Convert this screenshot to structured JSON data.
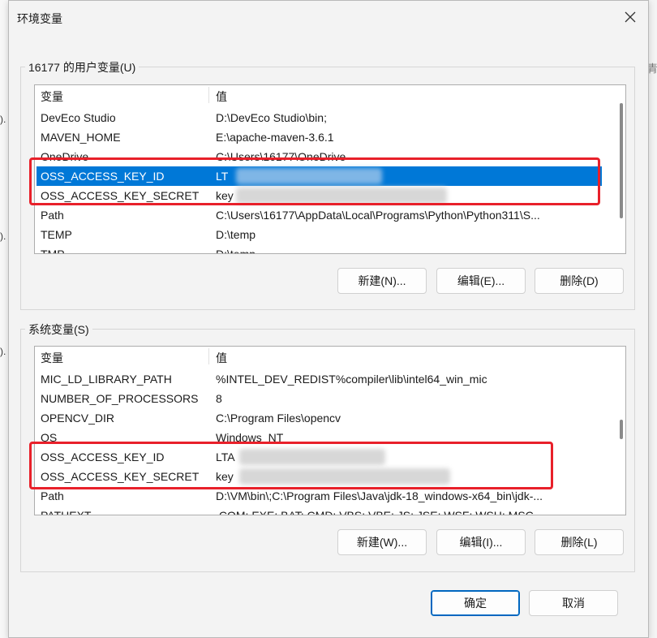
{
  "dialog": {
    "title": "环境变量"
  },
  "background": {
    "left_marks": [
      ").",
      ").",
      ")."
    ],
    "right_char": "青"
  },
  "user_vars": {
    "title": "16177 的用户变量(U)",
    "headers": {
      "variable": "变量",
      "value": "值"
    },
    "rows": [
      {
        "name": "DevEco Studio",
        "value": "D:\\DevEco Studio\\bin;"
      },
      {
        "name": "MAVEN_HOME",
        "value": "E:\\apache-maven-3.6.1"
      },
      {
        "name": "OneDrive",
        "value": "C:\\Users\\16177\\OneDrive"
      },
      {
        "name": "OSS_ACCESS_KEY_ID",
        "value": "LT",
        "selected": true
      },
      {
        "name": "OSS_ACCESS_KEY_SECRET",
        "value": "key"
      },
      {
        "name": "Path",
        "value": "C:\\Users\\16177\\AppData\\Local\\Programs\\Python\\Python311\\S..."
      },
      {
        "name": "TEMP",
        "value": "D:\\temp"
      },
      {
        "name": "TMP",
        "value": "D:\\temp"
      }
    ],
    "buttons": {
      "new": "新建(N)...",
      "edit": "编辑(E)...",
      "delete": "删除(D)"
    }
  },
  "system_vars": {
    "title": "系统变量(S)",
    "headers": {
      "variable": "变量",
      "value": "值"
    },
    "rows": [
      {
        "name": "MIC_LD_LIBRARY_PATH",
        "value": "%INTEL_DEV_REDIST%compiler\\lib\\intel64_win_mic"
      },
      {
        "name": "NUMBER_OF_PROCESSORS",
        "value": "8"
      },
      {
        "name": "OPENCV_DIR",
        "value": "C:\\Program Files\\opencv"
      },
      {
        "name": "OS",
        "value": "Windows_NT"
      },
      {
        "name": "OSS_ACCESS_KEY_ID",
        "value": "LTA"
      },
      {
        "name": "OSS_ACCESS_KEY_SECRET",
        "value": "key"
      },
      {
        "name": "Path",
        "value": "D:\\VM\\bin\\;C:\\Program Files\\Java\\jdk-18_windows-x64_bin\\jdk-..."
      },
      {
        "name": "PATHEXT",
        "value": ".COM;.EXE;.BAT;.CMD;.VBS;.VBE;.JS;.JSE;.WSF;.WSH;.MSC"
      }
    ],
    "buttons": {
      "new": "新建(W)...",
      "edit": "编辑(I)...",
      "delete": "删除(L)"
    }
  },
  "footer": {
    "ok": "确定",
    "cancel": "取消"
  },
  "colors": {
    "selection": "#0078d7",
    "highlight_box": "#e8202a",
    "primary_border": "#0067c0"
  },
  "icons": {
    "close": "close-icon"
  }
}
